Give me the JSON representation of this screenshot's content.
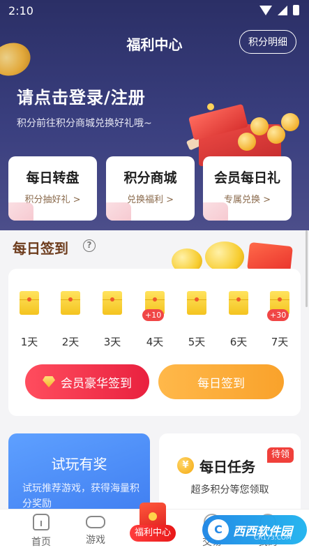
{
  "status_bar": {
    "time": "2:10"
  },
  "header": {
    "title": "福利中心",
    "points_detail_label": "积分明细"
  },
  "login": {
    "title": "请点击登录/注册",
    "subtitle": "积分前往积分商城兑换好礼哦~"
  },
  "features": [
    {
      "title": "每日转盘",
      "subtitle": "积分抽好礼 >"
    },
    {
      "title": "积分商城",
      "subtitle": "兑换福利 >"
    },
    {
      "title": "会员每日礼",
      "subtitle": "专属兑换 >"
    }
  ],
  "daily_signin": {
    "heading": "每日签到",
    "help_glyph": "?",
    "days": [
      {
        "label": "1天",
        "bonus": ""
      },
      {
        "label": "2天",
        "bonus": ""
      },
      {
        "label": "3天",
        "bonus": ""
      },
      {
        "label": "4天",
        "bonus": "+10"
      },
      {
        "label": "5天",
        "bonus": ""
      },
      {
        "label": "6天",
        "bonus": ""
      },
      {
        "label": "7天",
        "bonus": "+30"
      }
    ],
    "vip_button_label": "会员豪华签到",
    "daily_button_label": "每日签到"
  },
  "trial_card": {
    "title": "试玩有奖",
    "description": "试玩推荐游戏，获得海量积分奖励"
  },
  "task_card": {
    "coin_glyph": "¥",
    "title": "每日任务",
    "description": "超多积分等您领取",
    "badge": "待领"
  },
  "bottom_nav": {
    "items": [
      {
        "label": "首页",
        "icon": "home-icon"
      },
      {
        "label": "游戏",
        "icon": "gamepad-icon"
      },
      {
        "label": "福利中心",
        "icon": "red-envelope-icon"
      },
      {
        "label": "交易",
        "icon": "trade-icon"
      },
      {
        "label": "我的",
        "icon": "user-icon"
      }
    ]
  },
  "watermark": {
    "logo": "C",
    "text": "西西软件园",
    "url": "CR173.COM"
  },
  "colors": {
    "hero_bg": "#2b2f66",
    "accent_red": "#e9213f",
    "accent_orange": "#f9a22b",
    "trial_blue": "#3e7cf0",
    "heading_brown": "#6e3d1e"
  }
}
